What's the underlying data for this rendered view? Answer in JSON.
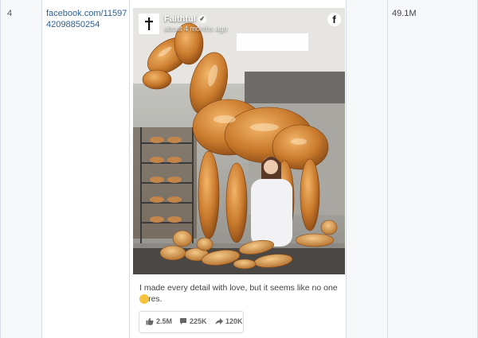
{
  "row": {
    "number": "4",
    "source_link": "facebook.com/1159742098850254",
    "count": "49.1M"
  },
  "post": {
    "page_name": "Faithful",
    "timestamp": "about 4 months ago",
    "platform_icon": "f",
    "caption": "I made every detail with love, but it seems like no one cares.",
    "caption_emoji": "🥰",
    "stats": {
      "likes": "2.5M",
      "comments": "225K",
      "shares": "120K"
    }
  },
  "colors": {
    "link": "#2c5f94",
    "column_bg": "#f6f8fa",
    "grid_line": "#d8dde3"
  }
}
